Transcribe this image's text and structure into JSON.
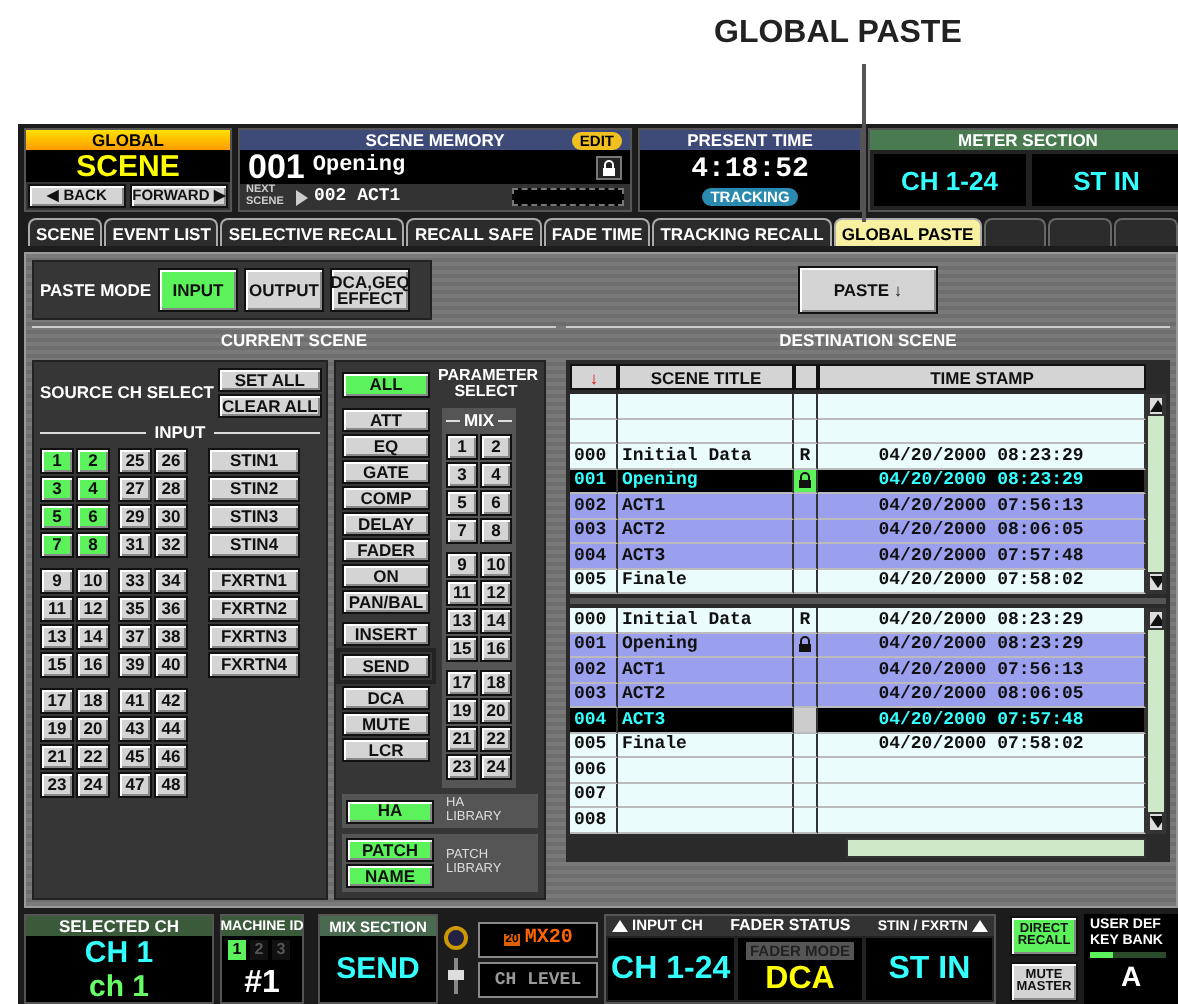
{
  "callout": {
    "label": "GLOBAL PASTE"
  },
  "global": {
    "header": "GLOBAL",
    "mode": "SCENE",
    "back": "◀ BACK",
    "forward": "FORWARD ▶"
  },
  "scene_memory": {
    "title": "SCENE MEMORY",
    "badge": "EDIT",
    "number": "001",
    "name": "Opening",
    "locked": true,
    "next_label": "NEXT SCENE",
    "next": "002 ACT1"
  },
  "present_time": {
    "title": "PRESENT TIME",
    "time": "4:18:52",
    "badge": "TRACKING"
  },
  "meter_section": {
    "title": "METER SECTION",
    "left": "CH 1-24",
    "right": "ST IN"
  },
  "tabs": [
    {
      "label": "SCENE",
      "selected": false
    },
    {
      "label": "EVENT LIST",
      "selected": false
    },
    {
      "label": "SELECTIVE RECALL",
      "selected": false
    },
    {
      "label": "RECALL SAFE",
      "selected": false
    },
    {
      "label": "FADE TIME",
      "selected": false
    },
    {
      "label": "TRACKING RECALL",
      "selected": false
    },
    {
      "label": "GLOBAL PASTE",
      "selected": true
    }
  ],
  "paste_mode": {
    "label": "PASTE MODE",
    "options": [
      {
        "label": "INPUT",
        "selected": true
      },
      {
        "label": "OUTPUT",
        "selected": false
      },
      {
        "label": "DCA,GEQ EFFECT",
        "selected": false
      }
    ]
  },
  "paste_button": "PASTE ↓",
  "current_scene": {
    "title": "CURRENT SCENE",
    "source": {
      "label": "SOURCE CH SELECT",
      "set_all": "SET ALL",
      "clear_all": "CLEAR ALL",
      "input_label": "INPUT",
      "channels": [
        {
          "label": "1",
          "selected": true
        },
        {
          "label": "2",
          "selected": true
        },
        {
          "label": "25",
          "selected": false
        },
        {
          "label": "26",
          "selected": false
        },
        {
          "label": "3",
          "selected": true
        },
        {
          "label": "4",
          "selected": true
        },
        {
          "label": "27",
          "selected": false
        },
        {
          "label": "28",
          "selected": false
        },
        {
          "label": "5",
          "selected": true
        },
        {
          "label": "6",
          "selected": true
        },
        {
          "label": "29",
          "selected": false
        },
        {
          "label": "30",
          "selected": false
        },
        {
          "label": "7",
          "selected": true
        },
        {
          "label": "8",
          "selected": true
        },
        {
          "label": "31",
          "selected": false
        },
        {
          "label": "32",
          "selected": false
        },
        {
          "label": "9",
          "selected": false
        },
        {
          "label": "10",
          "selected": false
        },
        {
          "label": "33",
          "selected": false
        },
        {
          "label": "34",
          "selected": false
        },
        {
          "label": "11",
          "selected": false
        },
        {
          "label": "12",
          "selected": false
        },
        {
          "label": "35",
          "selected": false
        },
        {
          "label": "36",
          "selected": false
        },
        {
          "label": "13",
          "selected": false
        },
        {
          "label": "14",
          "selected": false
        },
        {
          "label": "37",
          "selected": false
        },
        {
          "label": "38",
          "selected": false
        },
        {
          "label": "15",
          "selected": false
        },
        {
          "label": "16",
          "selected": false
        },
        {
          "label": "39",
          "selected": false
        },
        {
          "label": "40",
          "selected": false
        },
        {
          "label": "17",
          "selected": false
        },
        {
          "label": "18",
          "selected": false
        },
        {
          "label": "41",
          "selected": false
        },
        {
          "label": "42",
          "selected": false
        },
        {
          "label": "19",
          "selected": false
        },
        {
          "label": "20",
          "selected": false
        },
        {
          "label": "43",
          "selected": false
        },
        {
          "label": "44",
          "selected": false
        },
        {
          "label": "21",
          "selected": false
        },
        {
          "label": "22",
          "selected": false
        },
        {
          "label": "45",
          "selected": false
        },
        {
          "label": "46",
          "selected": false
        },
        {
          "label": "23",
          "selected": false
        },
        {
          "label": "24",
          "selected": false
        },
        {
          "label": "47",
          "selected": false
        },
        {
          "label": "48",
          "selected": false
        }
      ],
      "stereo": [
        {
          "label": "STIN1",
          "selected": false
        },
        {
          "label": "STIN2",
          "selected": false
        },
        {
          "label": "STIN3",
          "selected": false
        },
        {
          "label": "STIN4",
          "selected": false
        },
        {
          "label": "FXRTN1",
          "selected": false
        },
        {
          "label": "FXRTN2",
          "selected": false
        },
        {
          "label": "FXRTN3",
          "selected": false
        },
        {
          "label": "FXRTN4",
          "selected": false
        }
      ]
    },
    "parameters": {
      "title": "PARAMETER SELECT",
      "all": {
        "label": "ALL",
        "selected": true
      },
      "groups": [
        [
          {
            "label": "ATT",
            "selected": false
          },
          {
            "label": "EQ",
            "selected": false
          },
          {
            "label": "GATE",
            "selected": false
          },
          {
            "label": "COMP",
            "selected": false
          },
          {
            "label": "DELAY",
            "selected": false
          },
          {
            "label": "FADER",
            "selected": false
          },
          {
            "label": "ON",
            "selected": false
          },
          {
            "label": "PAN/BAL",
            "selected": false
          }
        ],
        [
          {
            "label": "INSERT",
            "selected": false
          }
        ],
        [
          {
            "label": "SEND",
            "selected": false
          }
        ],
        [
          {
            "label": "DCA",
            "selected": false
          },
          {
            "label": "MUTE",
            "selected": false
          },
          {
            "label": "LCR",
            "selected": false
          }
        ]
      ],
      "mix_label": "MIX",
      "mix": [
        {
          "label": "1",
          "selected": false
        },
        {
          "label": "2",
          "selected": false
        },
        {
          "label": "3",
          "selected": false
        },
        {
          "label": "4",
          "selected": false
        },
        {
          "label": "5",
          "selected": false
        },
        {
          "label": "6",
          "selected": false
        },
        {
          "label": "7",
          "selected": false
        },
        {
          "label": "8",
          "selected": false
        },
        {
          "label": "9",
          "selected": false
        },
        {
          "label": "10",
          "selected": false
        },
        {
          "label": "11",
          "selected": false
        },
        {
          "label": "12",
          "selected": false
        },
        {
          "label": "13",
          "selected": false
        },
        {
          "label": "14",
          "selected": false
        },
        {
          "label": "15",
          "selected": false
        },
        {
          "label": "16",
          "selected": false
        },
        {
          "label": "17",
          "selected": false
        },
        {
          "label": "18",
          "selected": false
        },
        {
          "label": "19",
          "selected": false
        },
        {
          "label": "20",
          "selected": false
        },
        {
          "label": "21",
          "selected": false
        },
        {
          "label": "22",
          "selected": false
        },
        {
          "label": "23",
          "selected": false
        },
        {
          "label": "24",
          "selected": false
        }
      ],
      "libraries": [
        {
          "label": "HA LIBRARY",
          "buttons": [
            {
              "label": "HA",
              "selected": true
            }
          ]
        },
        {
          "label": "PATCH LIBRARY",
          "buttons": [
            {
              "label": "PATCH",
              "selected": true
            },
            {
              "label": "NAME",
              "selected": true
            }
          ]
        }
      ]
    }
  },
  "destination": {
    "title": "DESTINATION SCENE",
    "columns": [
      "↓",
      "SCENE TITLE",
      "TIME STAMP"
    ],
    "source_list": [
      {
        "selected": false,
        "in_range": false
      },
      {
        "selected": false,
        "in_range": false
      },
      {
        "number": "000",
        "title": "Initial Data",
        "flag": "R",
        "time": "04/20/2000 08:23:29",
        "selected": false,
        "in_range": false
      },
      {
        "number": "001",
        "title": "Opening",
        "locked": true,
        "time": "04/20/2000 08:23:29",
        "selected": true,
        "in_range": false
      },
      {
        "number": "002",
        "title": "ACT1",
        "time": "04/20/2000 07:56:13",
        "selected": false,
        "in_range": true
      },
      {
        "number": "003",
        "title": "ACT2",
        "time": "04/20/2000 08:06:05",
        "selected": false,
        "in_range": true
      },
      {
        "number": "004",
        "title": "ACT3",
        "time": "04/20/2000 07:57:48",
        "selected": false,
        "in_range": true
      },
      {
        "number": "005",
        "title": "Finale",
        "time": "04/20/2000 07:58:02",
        "selected": false,
        "in_range": false
      }
    ],
    "target_list": [
      {
        "number": "000",
        "title": "Initial Data",
        "flag": "R",
        "time": "04/20/2000 08:23:29",
        "selected": false,
        "in_range": false
      },
      {
        "number": "001",
        "title": "Opening",
        "locked": true,
        "time": "04/20/2000 08:23:29",
        "selected": false,
        "in_range": true
      },
      {
        "number": "002",
        "title": "ACT1",
        "time": "04/20/2000 07:56:13",
        "selected": false,
        "in_range": true
      },
      {
        "number": "003",
        "title": "ACT2",
        "time": "04/20/2000 08:06:05",
        "selected": false,
        "in_range": true
      },
      {
        "number": "004",
        "title": "ACT3",
        "time": "04/20/2000 07:57:48",
        "selected": true,
        "in_range": false
      },
      {
        "number": "005",
        "title": "Finale",
        "time": "04/20/2000 07:58:02",
        "selected": false,
        "in_range": false
      },
      {
        "number": "006",
        "selected": false,
        "in_range": false
      },
      {
        "number": "007",
        "selected": false,
        "in_range": false
      },
      {
        "number": "008",
        "selected": false,
        "in_range": false
      }
    ]
  },
  "status_bar": {
    "selected_ch": {
      "title": "SELECTED CH",
      "primary": "CH 1",
      "secondary": "ch 1"
    },
    "machine_id": {
      "title": "MACHINE ID",
      "ids": [
        {
          "label": "1",
          "selected": true
        },
        {
          "label": "2",
          "selected": false
        },
        {
          "label": "3",
          "selected": false
        }
      ],
      "value": "#1"
    },
    "mix_section": {
      "title": "MIX SECTION",
      "value": "SEND"
    },
    "mix_display": {
      "badge": "20",
      "name": "MX20",
      "level": "CH LEVEL"
    },
    "fader_status": {
      "left_label": "INPUT CH",
      "title": "FADER STATUS",
      "right_label": "STIN / FXRTN",
      "left": "CH 1-24",
      "mode_label": "FADER MODE",
      "mode": "DCA",
      "right": "ST IN"
    },
    "direct_recall": {
      "label": "DIRECT RECALL",
      "on": true
    },
    "mute_master": "MUTE MASTER",
    "user_key": {
      "title": "USER DEF KEY BANK",
      "value": "A"
    }
  }
}
